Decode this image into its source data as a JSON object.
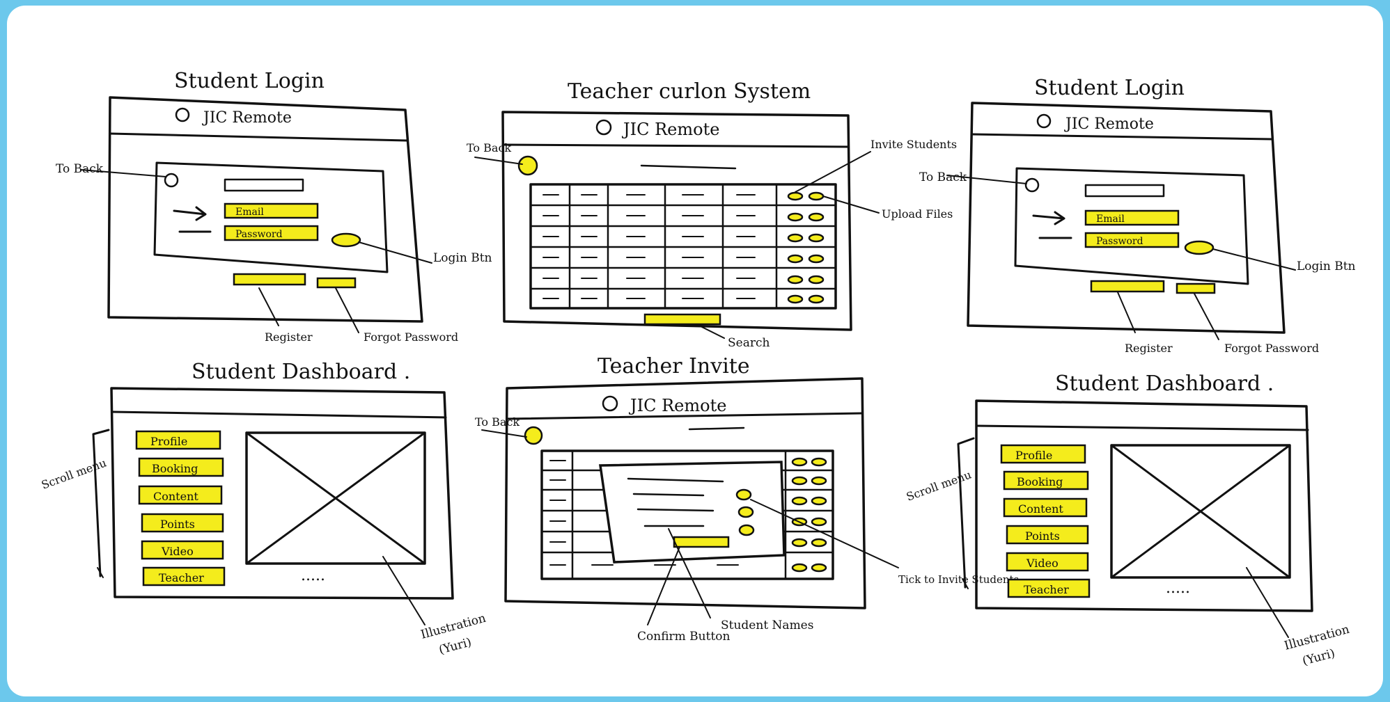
{
  "titles": {
    "student_login": "Student Login",
    "teacher_system": "Teacher curlon System",
    "student_dashboard": "Student Dashboard .",
    "teacher_invite": "Teacher Invite"
  },
  "app_name": "JIC Remote",
  "login": {
    "email": "Email",
    "password": "Password",
    "to_back": "To Back",
    "login_btn": "Login Btn",
    "register": "Register",
    "forgot": "Forgot Password"
  },
  "teacher": {
    "to_back": "To Back",
    "invite_students": "Invite Students",
    "upload_files": "Upload Files",
    "search": "Search"
  },
  "dashboard": {
    "menu": [
      "Profile",
      "Booking",
      "Content",
      "Points",
      "Video",
      "Teacher"
    ],
    "scroll_menu": "Scroll menu",
    "illustration": "Illustration",
    "illustration_sub": "(Yuri)",
    "ellipsis": "....."
  },
  "invite": {
    "to_back": "To Back",
    "tick": "Tick to Invite Students",
    "confirm": "Confirm Button",
    "names": "Student Names"
  },
  "colors": {
    "highlight": "#f4ec1c",
    "ink": "#111111",
    "frame": "#6cc8ec"
  }
}
